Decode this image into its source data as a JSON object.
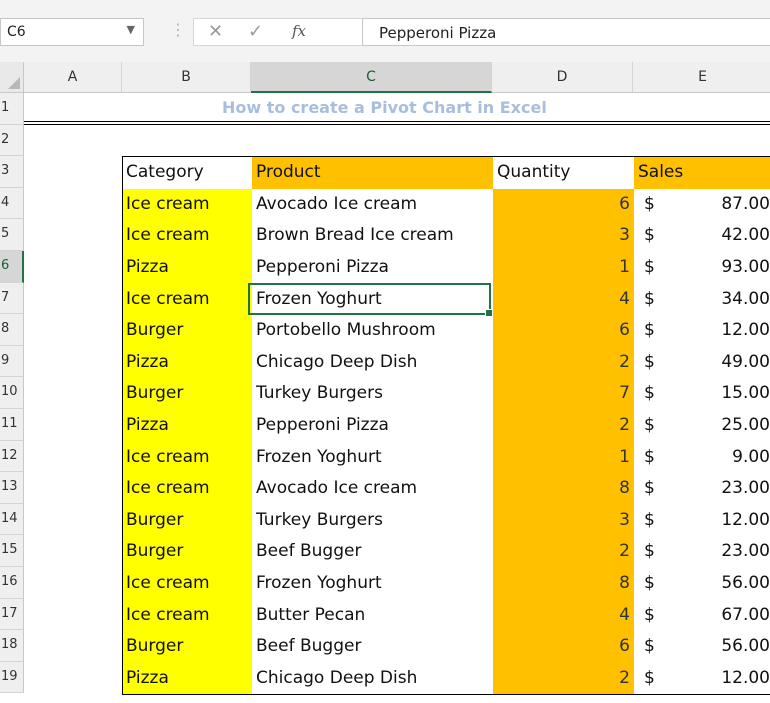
{
  "formula_bar": {
    "name_box": "C6",
    "formula": "Pepperoni Pizza"
  },
  "columns": [
    "A",
    "B",
    "C",
    "D",
    "E"
  ],
  "selected_column": "C",
  "rows": [
    "1",
    "2",
    "3",
    "4",
    "5",
    "6",
    "7",
    "8",
    "9",
    "10",
    "11",
    "12",
    "13",
    "14",
    "15",
    "16",
    "17",
    "18",
    "19"
  ],
  "selected_row": "6",
  "title": "How to create a Pivot Chart in Excel",
  "table": {
    "headers": {
      "category": "Category",
      "product": "Product",
      "quantity": "Quantity",
      "sales": "Sales"
    },
    "currency_symbol": "$",
    "rows": [
      {
        "category": "Ice cream",
        "product": "Avocado Ice cream",
        "quantity": "6",
        "sales": "87.00"
      },
      {
        "category": "Ice cream",
        "product": "Brown Bread Ice cream",
        "quantity": "3",
        "sales": "42.00"
      },
      {
        "category": "Pizza",
        "product": "Pepperoni Pizza",
        "quantity": "1",
        "sales": "93.00"
      },
      {
        "category": "Ice cream",
        "product": "Frozen Yoghurt",
        "quantity": "4",
        "sales": "34.00"
      },
      {
        "category": "Burger",
        "product": "Portobello Mushroom",
        "quantity": "6",
        "sales": "12.00"
      },
      {
        "category": "Pizza",
        "product": "Chicago Deep Dish",
        "quantity": "2",
        "sales": "49.00"
      },
      {
        "category": "Burger",
        "product": "Turkey Burgers",
        "quantity": "7",
        "sales": "15.00"
      },
      {
        "category": "Pizza",
        "product": "Pepperoni Pizza",
        "quantity": "2",
        "sales": "25.00"
      },
      {
        "category": "Ice cream",
        "product": "Frozen Yoghurt",
        "quantity": "1",
        "sales": "9.00"
      },
      {
        "category": "Ice cream",
        "product": "Avocado Ice cream",
        "quantity": "8",
        "sales": "23.00"
      },
      {
        "category": "Burger",
        "product": "Turkey Burgers",
        "quantity": "3",
        "sales": "12.00"
      },
      {
        "category": "Burger",
        "product": "Beef Bugger",
        "quantity": "2",
        "sales": "23.00"
      },
      {
        "category": "Ice cream",
        "product": "Frozen Yoghurt",
        "quantity": "8",
        "sales": "56.00"
      },
      {
        "category": "Ice cream",
        "product": "Butter Pecan",
        "quantity": "4",
        "sales": "67.00"
      },
      {
        "category": "Burger",
        "product": "Beef Bugger",
        "quantity": "6",
        "sales": "56.00"
      },
      {
        "category": "Pizza",
        "product": "Chicago Deep Dish",
        "quantity": "2",
        "sales": "12.00"
      }
    ]
  },
  "colors": {
    "category_fill": "#ffff00",
    "highlight_fill": "#ffc000",
    "selection_accent": "#217346",
    "title_text": "#a7bedd"
  }
}
